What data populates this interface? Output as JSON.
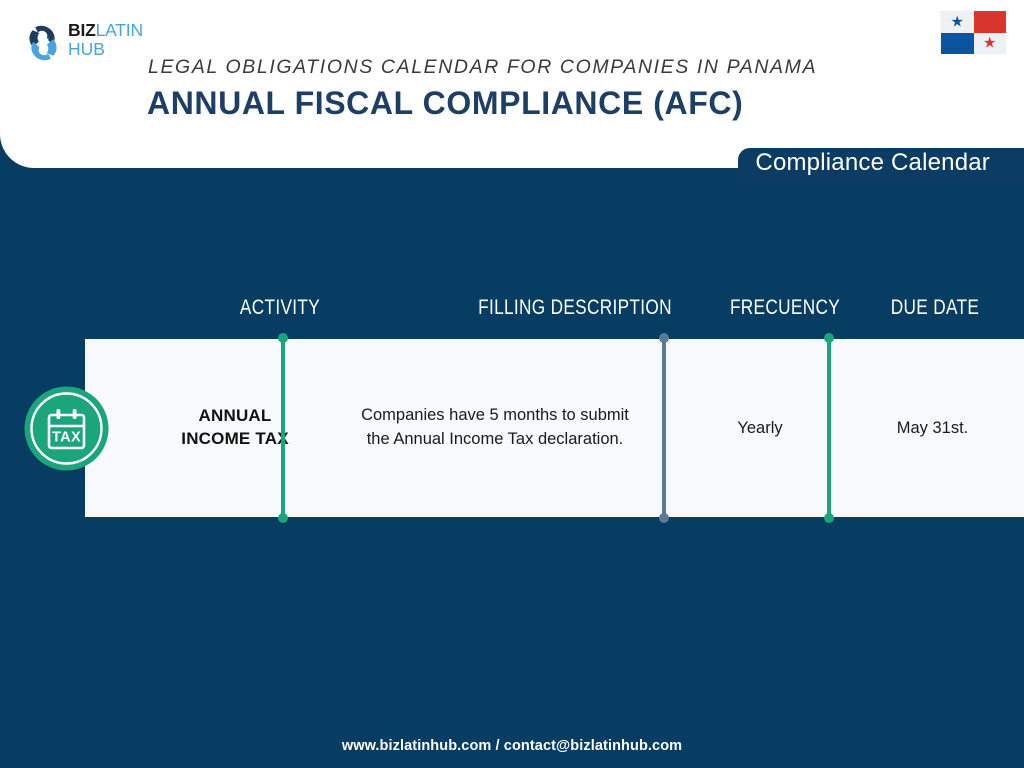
{
  "brand": {
    "logo_line1_bold": "BIZ",
    "logo_line1_light": "LATIN",
    "logo_line2": "HUB",
    "logo_icon": "bizlatinhub-infinity-icon",
    "colors": {
      "navy": "#083d63",
      "title_navy": "#1d3f66",
      "logo_light_blue": "#4aa3dd",
      "accent_green": "#1aa67a",
      "divider_gray": "#5a7a95",
      "card_bg": "#f7f9fc"
    }
  },
  "header": {
    "subtitle": "LEGAL OBLIGATIONS CALENDAR FOR COMPANIES IN PANAMA",
    "title": "ANNUAL FISCAL COMPLIANCE (AFC)",
    "badge": "Compliance Calendar",
    "flag": {
      "name": "panama-flag",
      "quadrants": [
        {
          "fill": "#eef1f4",
          "star": "#0a55a0"
        },
        {
          "fill": "#d9352c",
          "star": null
        },
        {
          "fill": "#0a55a0",
          "star": null
        },
        {
          "fill": "#eef1f4",
          "star": "#d9352c"
        }
      ]
    }
  },
  "table": {
    "columns": [
      {
        "key": "activity",
        "label": "ACTIVITY"
      },
      {
        "key": "description",
        "label": "FILLING DESCRIPTION"
      },
      {
        "key": "frequency",
        "label": "FRECUENCY"
      },
      {
        "key": "duedate",
        "label": "DUE DATE"
      }
    ],
    "rows": [
      {
        "icon": "tax-calendar-icon",
        "icon_label": "TAX",
        "activity": "ANNUAL\nINCOME TAX",
        "activity_line1": "ANNUAL",
        "activity_line2": "INCOME TAX",
        "description": "Companies have 5 months to submit the Annual Income Tax declaration.",
        "description_line1": "Companies have 5 months to submit",
        "description_line2": "the Annual Income Tax declaration.",
        "frequency": "Yearly",
        "duedate": "May 31st."
      }
    ],
    "dividers": [
      {
        "name": "divider-activity-description",
        "color": "#1aa67a"
      },
      {
        "name": "divider-description-frequency",
        "color": "#5a7a95"
      },
      {
        "name": "divider-frequency-duedate",
        "color": "#1aa67a"
      }
    ]
  },
  "footer": {
    "text": "www.bizlatinhub.com / contact@bizlatinhub.com"
  }
}
